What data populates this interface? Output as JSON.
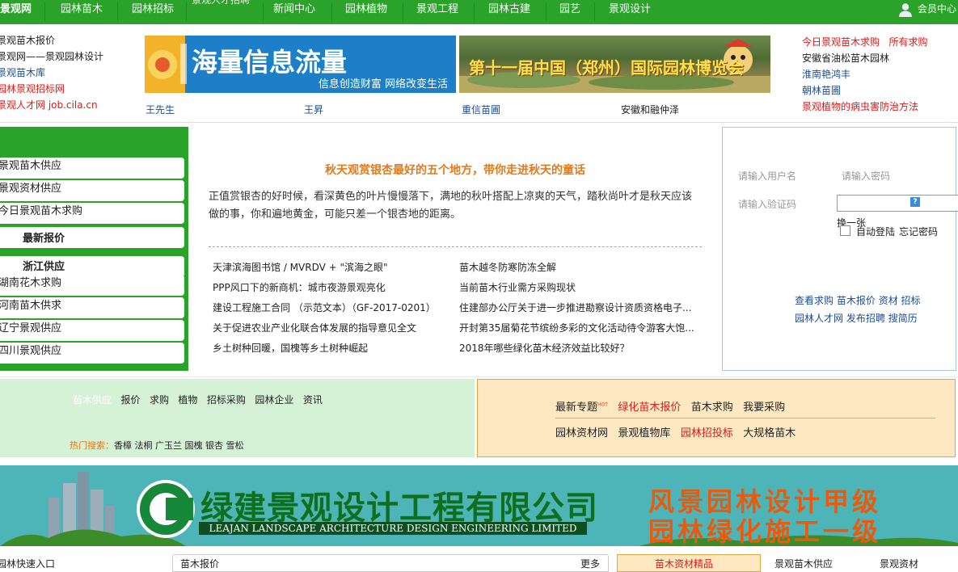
{
  "nav": {
    "items": [
      "景观网",
      "园林苗木",
      "园林招标",
      "景观人才招聘",
      "新闻中心",
      "园林植物",
      "景观工程",
      "园林古建",
      "园艺",
      "景观设计"
    ],
    "member": "会员中心"
  },
  "left_links": [
    "景观苗木报价",
    "景观网——景观园林设计",
    "景观苗木库",
    "园林景观招标网",
    "景观人才网 job.cila.cn"
  ],
  "banner1": {
    "main": "海量信息流量",
    "sub": "信息创造财富 网络改变生活"
  },
  "banner2": {
    "main": "第十一届中国（郑州）国际园林博览会"
  },
  "banner_captions": [
    "王先生",
    "王昇",
    "重信苗圃",
    "安徽和融仲泽"
  ],
  "right_links": {
    "header1": "今日景观苗木求购",
    "header2": "所有求购",
    "items": [
      "安徽省油松苗木园林",
      "淮南艳鸿丰",
      "朝林苗圃",
      "景观植物的病虫害防治方法"
    ]
  },
  "green_panel": {
    "items": [
      "景观苗木供应",
      "景观资材供应",
      "今日景观苗木求购"
    ],
    "title1": "最新报价",
    "title2": "浙江供应",
    "items2": [
      "湖南花木求购",
      "河南苗木供求",
      "辽宁景观供应",
      "四川景观供应"
    ]
  },
  "headline": "秋天观赏银杏最好的五个地方，带你走进秋天的童话",
  "summary": "正值赏银杏的好时候，看深黄色的叶片慢慢落下，满地的秋叶搭配上凉爽的天气，踏秋尚叶才是秋天应该做的事，你和遍地黄金，可能只差一个银杏地的距离。",
  "news_left": [
    "天津滨海图书馆 / MVRDV + \"滨海之眼\"",
    "PPP风口下的新商机：城市夜游景观亮化",
    "建设工程施工合同 （示范文本）（GF-2017-0201）",
    "关于促进农业产业化联合体发展的指导意见全文",
    "乡土树种回暖，国槐等乡土树种崛起"
  ],
  "news_right": [
    "苗木越冬防寒防冻全解",
    "当前苗木行业需方采购现状",
    "住建部办公厅关于进一步推进勘察设计资质资格电子...",
    "开封第35届菊花节缤纷多彩的文化活动待令游客大饱...",
    "2018年哪些绿化苗木经济效益比较好？"
  ],
  "login": {
    "username_placeholder": "请输入用户名",
    "password_placeholder": "请输入密码",
    "captcha_placeholder": "请输入验证码",
    "captcha_q": "?",
    "refresh": "换一张",
    "auto_login": "自动登陆",
    "forgot": "忘记密码",
    "links1": [
      "查看求购",
      "苗木报价",
      "资材",
      "招标"
    ],
    "links2": [
      "园林人才网",
      "发布招聘",
      "搜简历"
    ]
  },
  "search": {
    "tabs": [
      "苗木供应",
      "报价",
      "求购",
      "植物",
      "招标采购",
      "园林企业",
      "资讯"
    ],
    "hot_label": "热门搜索：",
    "hot": [
      "香樟",
      "法桐",
      "广玉兰",
      "国槐",
      "银杏",
      "雪松"
    ]
  },
  "topics": {
    "label": "最新专题",
    "hot_tag": "HOT",
    "row1": [
      "绿化苗木报价",
      "苗木求购",
      "我要采购"
    ],
    "row2": [
      "园林资材网",
      "景观植物库",
      "园林招投标",
      "大规格苗木"
    ]
  },
  "ad": {
    "title": "绿建景观设计工程有限公司",
    "subtitle": "LEAJAN LANDSCAPE ARCHITECTURE DESIGN ENGINEERING LIMITED",
    "right1": "风景园林设计甲级",
    "right2": "园林绿化施工一级"
  },
  "bottom": {
    "left": "园林快速入口",
    "mid": "苗木报价",
    "more": "更多",
    "tabs": [
      "苗木资材精品",
      "景观苗木供应",
      "景观资材"
    ]
  }
}
